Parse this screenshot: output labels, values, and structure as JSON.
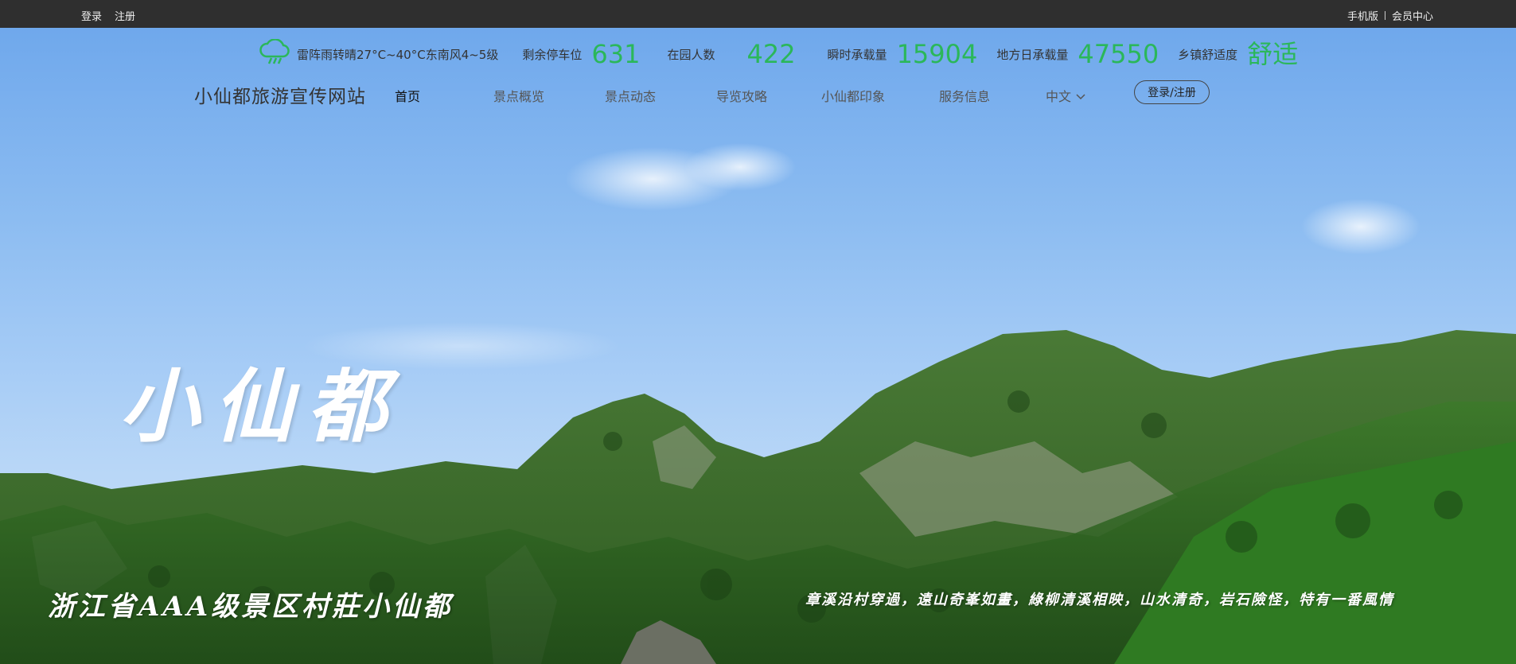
{
  "topbar": {
    "login": "登录",
    "register": "注册",
    "mobile": "手机版",
    "member_center": "会员中心"
  },
  "info": {
    "weather_icon": "cloud-rain-icon",
    "weather": "雷阵雨转晴27°C~40°C东南风4~5级",
    "stats": [
      {
        "label": "剩余停车位",
        "value": "631"
      },
      {
        "label": "在园人数",
        "value": "422"
      },
      {
        "label": "瞬时承载量",
        "value": "15904"
      },
      {
        "label": "地方日承载量",
        "value": "47550"
      },
      {
        "label": "乡镇舒适度",
        "value": "舒适"
      }
    ],
    "accent_color": "#2bb75a"
  },
  "nav": {
    "brand": "小仙都旅游宣传网站",
    "items": [
      "首页",
      "景点概览",
      "景点动态",
      "导览攻略",
      "小仙都印象",
      "服务信息"
    ],
    "language": "中文",
    "login_register": "登录/注册"
  },
  "hero": {
    "calligraphy": "小仙都",
    "tagline_left": "浙江省AAA级景区村莊小仙都",
    "tagline_right": "章溪沿村穿過，遠山奇峯如畫，綠柳清溪相映，山水清奇，岩石險怪，特有一番風情"
  }
}
